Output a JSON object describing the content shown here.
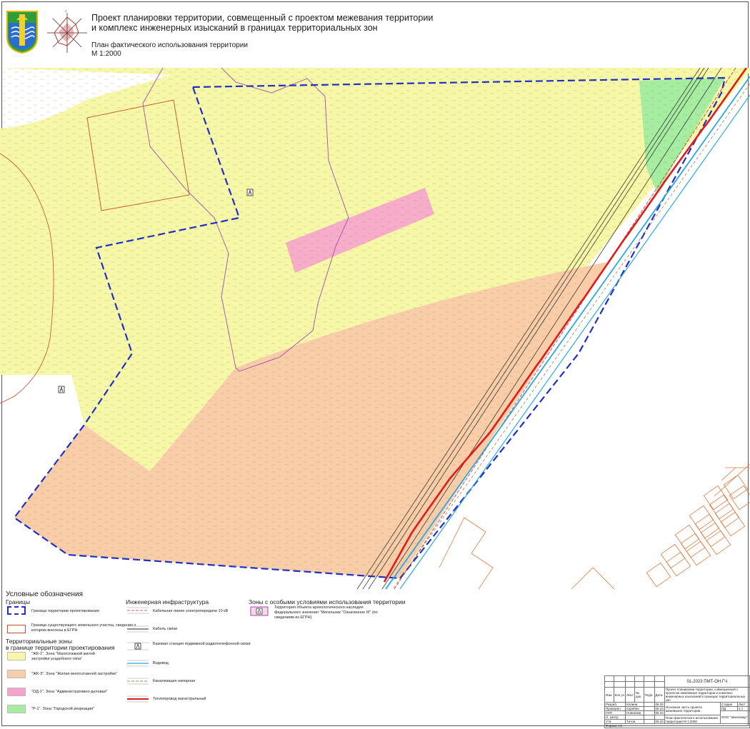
{
  "header": {
    "title_line1": "Проект планировки территории, совмещенный с проектом межевания территории",
    "title_line2": "и комплекс инженерных изысканий в границах территориальных зон",
    "plan_name": "План фактического использования территории",
    "scale": "М 1:2000"
  },
  "icons": {
    "emblem": "coat-of-arms-icon",
    "compass": "wind-rose-icon",
    "radio_station": "radio-tower-icon",
    "heritage": "heritage-site-icon"
  },
  "colors": {
    "zone_zh1": "#f7f7a8",
    "zone_zh3": "#f8cda8",
    "zone_od1": "#f6a3cc",
    "zone_r1": "#a6eda1",
    "project_boundary": "#1f2fc8",
    "parcel_boundary": "#c0502a",
    "heritage_boundary": "#a14db0",
    "power_cable": "#cc2a2a",
    "comm_cable": "#222222",
    "water": "#2aa9e0",
    "sewer": "#8a5a2a",
    "heat": "#e01b1b"
  },
  "legend": {
    "title": "Условные обозначения",
    "boundaries_head": "Границы",
    "project_boundary": "Граница территории проектирования",
    "parcel_boundary": "Граница существующего земельного участка, сведения о котором внесены в ЕГРН",
    "zones_head_1": "Территориальные зоны",
    "zones_head_2": "в границе территории проектирования",
    "zh1": "\"ЖК-1\". Зона \"Малоэтажной жилой застройки усадебного типа\"",
    "zh3": "\"ЖК-3\". Зона \"Жилая многоэтажной застройки\"",
    "od1": "\"ОД-1\". Зона \"Административно-деловая\"",
    "r1": "\"Р-1\". Зона \"Городской рекреации\"",
    "infra_head": "Инженерная инфраструктура",
    "power_cable": "Кабельная линия электропередачи 10 кВ",
    "comm_cable": "Кабель связи",
    "base_station": "Базовая станция подвижной радиотелефонной связи",
    "water": "Водовод",
    "sewer": "Канализация напорная",
    "heat": "Теплопровод магистральный",
    "special_head": "Зоны с особыми условиями использования территории",
    "heritage": "Территория объекта археологического наследия федерального значения \"Могильник \"Означенное III\" (по сведениям из ЕГРН)"
  },
  "stamp": {
    "code": "01-2023 ПМТ-ОН.ГЧ",
    "project": "Проект планировки территории, совмещенный с проектом межевания территории и комплекс инженерных изысканий в границах территориальных зон",
    "part": "Основная часть проекта межевания территории",
    "sheet_title": "План фактического использования территории М 1:2000",
    "stage": "Стадия",
    "stage_value": "ПД",
    "sheet": "Лист",
    "sheet_value": "2.1",
    "org": "ООО \"Землемер\"",
    "rows": [
      "Разраб.",
      "Проверил",
      "ГИП",
      "Н. контр.",
      "Утв."
    ],
    "names": [
      "Колина",
      "Скрябин",
      "Новикова",
      "",
      "Титов"
    ],
    "dates": [
      "06.23",
      "06.23",
      "06.23",
      "",
      "06.23"
    ],
    "cols": [
      "Изм.",
      "Кол.уч",
      "Лист",
      "№ док.",
      "Подп.",
      "Дата"
    ],
    "format": "Формат А4"
  }
}
